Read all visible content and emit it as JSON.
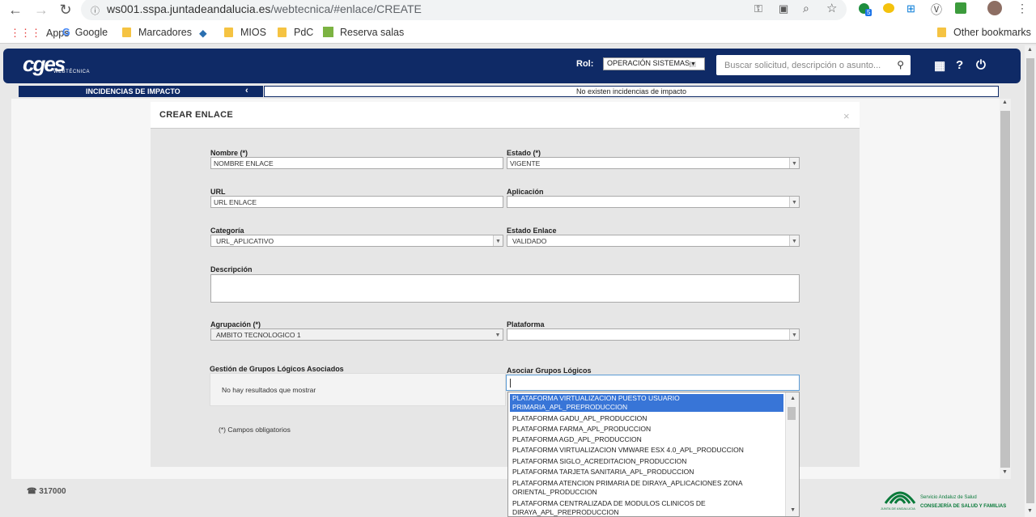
{
  "browser": {
    "url_host": "ws001.sspa.juntadeandalucia.es",
    "url_path": "/webtecnica/#enlace/CREATE",
    "bookmarks": [
      "Apps",
      "Google",
      "Marcadores",
      "MIOS",
      "PdC",
      "Reserva salas"
    ],
    "other_bookmarks": "Other bookmarks",
    "badge_count": "5"
  },
  "header": {
    "logo": "cges",
    "logo_sub": "WEBTÉCNICA",
    "rol_label": "Rol:",
    "rol_value": "OPERACIÓN SISTEMAS",
    "search_placeholder": "Buscar solicitud, descripción o asunto...",
    "brand_color": "#0f2a66"
  },
  "incidencias": {
    "title": "INCIDENCIAS DE IMPACTO",
    "message": "No existen incidencias de impacto"
  },
  "modal": {
    "title": "CREAR ENLACE",
    "close": "×",
    "fields": {
      "nombre_label": "Nombre (*)",
      "nombre_value": "NOMBRE ENLACE",
      "estado_label": "Estado (*)",
      "estado_value": "VIGENTE",
      "url_label": "URL",
      "url_value": "URL ENLACE",
      "aplicacion_label": "Aplicación",
      "aplicacion_value": "",
      "categoria_label": "Categoría",
      "categoria_value": "URL_APLICATIVO",
      "estado_enlace_label": "Estado Enlace",
      "estado_enlace_value": "VALIDADO",
      "descripcion_label": "Descripción",
      "agrupacion_label": "Agrupación (*)",
      "agrupacion_value": "AMBITO TECNOLOGICO 1",
      "plataforma_label": "Plataforma",
      "plataforma_value": ""
    },
    "grupos_label": "Gestión de Grupos Lógicos Asociados",
    "grupos_empty": "No hay resultados que mostrar",
    "asociar_label": "Asociar Grupos Lógicos",
    "required_note": "(*) Campos obligatorios",
    "dropdown_options": [
      "PLATAFORMA VIRTUALIZACION PUESTO USUARIO PRIMARIA_APL_PREPRODUCCION",
      "PLATAFORMA GADU_APL_PRODUCCION",
      "PLATAFORMA FARMA_APL_PRODUCCION",
      "PLATAFORMA AGD_APL_PRODUCCION",
      "PLATAFORMA VIRTUALIZACION VMWARE ESX 4.0_APL_PRODUCCION",
      "PLATAFORMA SIGLO_ACREDITACION_PRODUCCION",
      "PLATAFORMA TARJETA SANITARIA_APL_PRODUCCION",
      "PLATAFORMA ATENCION PRIMARIA DE DIRAYA_APLICACIONES ZONA ORIENTAL_PRODUCCION",
      "PLATAFORMA CENTRALIZADA DE MODULOS CLINICOS DE DIRAYA_APL_PREPRODUCCION"
    ]
  },
  "footer": {
    "phone": "317000",
    "sas": "Servicio Andaluz de Salud",
    "consejeria": "CONSEJERÍA DE SALUD Y FAMILIAS",
    "junta": "JUNTA DE ANDALUCIA"
  }
}
